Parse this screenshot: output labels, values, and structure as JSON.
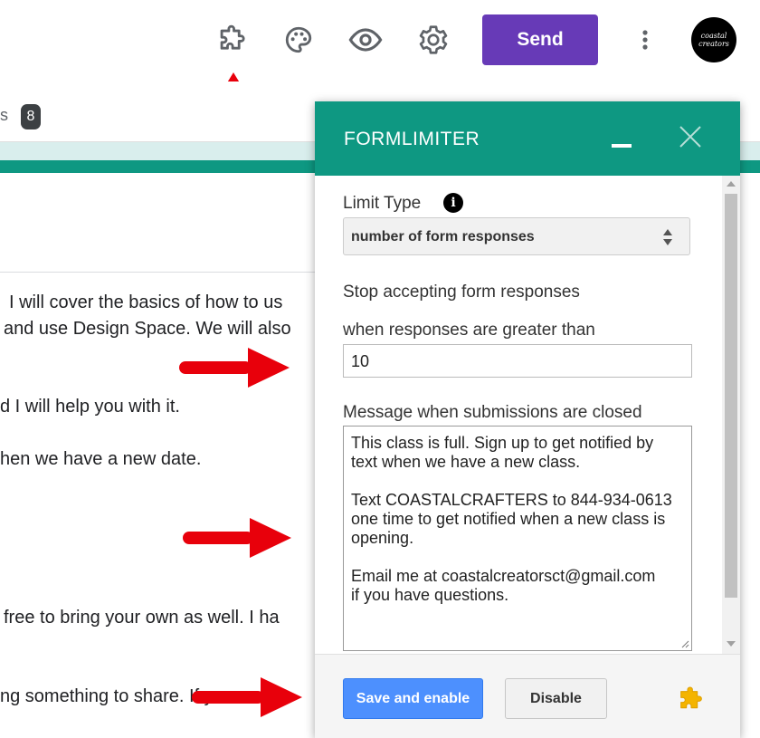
{
  "toolbar": {
    "send_label": "Send",
    "avatar_text_line1": "coastal",
    "avatar_text_line2": "creators",
    "icons": [
      "puzzle-icon",
      "palette-icon",
      "eye-icon",
      "gear-icon",
      "more-vert-icon"
    ]
  },
  "tabs": {
    "partial_label": "s",
    "responses_count": "8"
  },
  "form_body": {
    "lines": [
      "I will cover the basics of how to us",
      "and use Design Space. We will also",
      "d I will help you with it.",
      "hen we have a new date.",
      "free to bring your own as well. I ha",
      "ng something to share. If you"
    ]
  },
  "panel": {
    "title": "FORMLIMITER",
    "limit_type_label": "Limit Type",
    "info_symbol": "i",
    "limit_type_value": "number of form responses",
    "stop_label": "Stop accepting form responses",
    "threshold_label": "when responses are greater than",
    "threshold_value": "10",
    "message_label": "Message when submissions are closed",
    "message_lines": [
      "This class is full. Sign up to get notified by",
      "text when we have a new class.",
      "",
      "Text COASTALCRAFTERS to 844-934-0613",
      "one time to get notified when a new class is",
      "opening.",
      "",
      "Email me at coastalcreatorsct@gmail.com",
      "if you have questions."
    ],
    "save_label": "Save and enable",
    "disable_label": "Disable"
  },
  "colors": {
    "teal": "#0e9882",
    "purple": "#673ab7",
    "blue_button": "#4d90fe",
    "arrow_red": "#e8000b"
  }
}
